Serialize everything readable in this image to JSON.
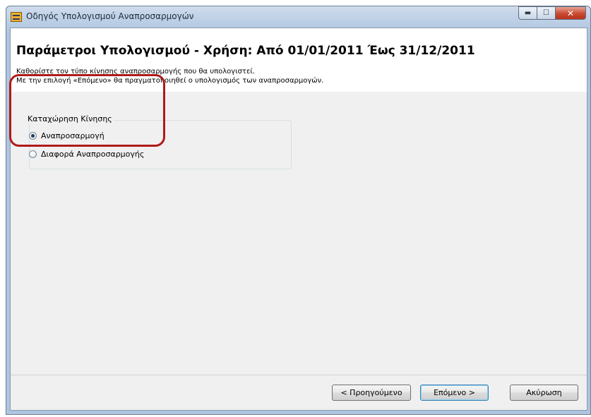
{
  "window": {
    "title": "Οδηγός Υπολογισμού Αναπροσαρμογών",
    "min_symbol": "▬",
    "max_symbol": "☐",
    "close_symbol": "✕"
  },
  "header": {
    "page_title": "Παράμετροι Υπολογισμού - Χρήση: Από 01/01/2011 Έως 31/12/2011",
    "description_line1": "Καθορίστε τον τύπο κίνησης αναπροσαρμογής που θα υπολογιστεί.",
    "description_line2": "Με την επιλογή «Επόμενο» θα πραγματοποιηθεί ο υπολογισμός των αναπροσαρμογών."
  },
  "group": {
    "legend": "Καταχώρηση Κίνησης",
    "options": [
      {
        "label": "Αναπροσαρμογή",
        "checked": true
      },
      {
        "label": "Διαφορά Αναπροσαρμογής",
        "checked": false
      }
    ],
    "highlight_color": "#b01a1a"
  },
  "footer": {
    "prev_label": "< Προηγούμενο",
    "next_label": "Επόμενο >",
    "cancel_label": "Ακύρωση"
  },
  "icons": {
    "app": "wizard-app-icon"
  }
}
